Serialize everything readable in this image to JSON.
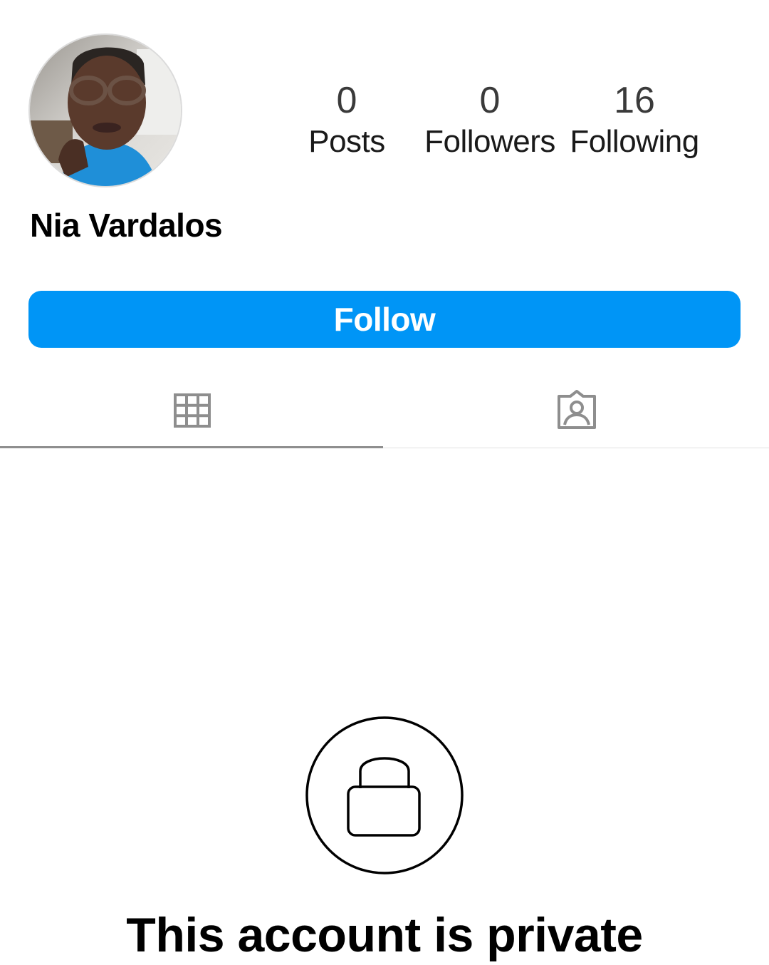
{
  "profile": {
    "name": "Nia Vardalos",
    "avatar_icon": "profile-photo"
  },
  "stats": {
    "posts": {
      "value": "0",
      "label": "Posts"
    },
    "followers": {
      "value": "0",
      "label": "Followers"
    },
    "following": {
      "value": "16",
      "label": "Following"
    }
  },
  "actions": {
    "follow_label": "Follow"
  },
  "tabs": [
    {
      "icon": "grid-icon",
      "active": true
    },
    {
      "icon": "tagged-person-icon",
      "active": false
    }
  ],
  "private_notice": {
    "icon": "lock-icon",
    "title": "This account is private"
  },
  "colors": {
    "accent": "#0095f6",
    "tab_indicator": "#8e8e8e",
    "icon_gray": "#8e8e8e"
  }
}
